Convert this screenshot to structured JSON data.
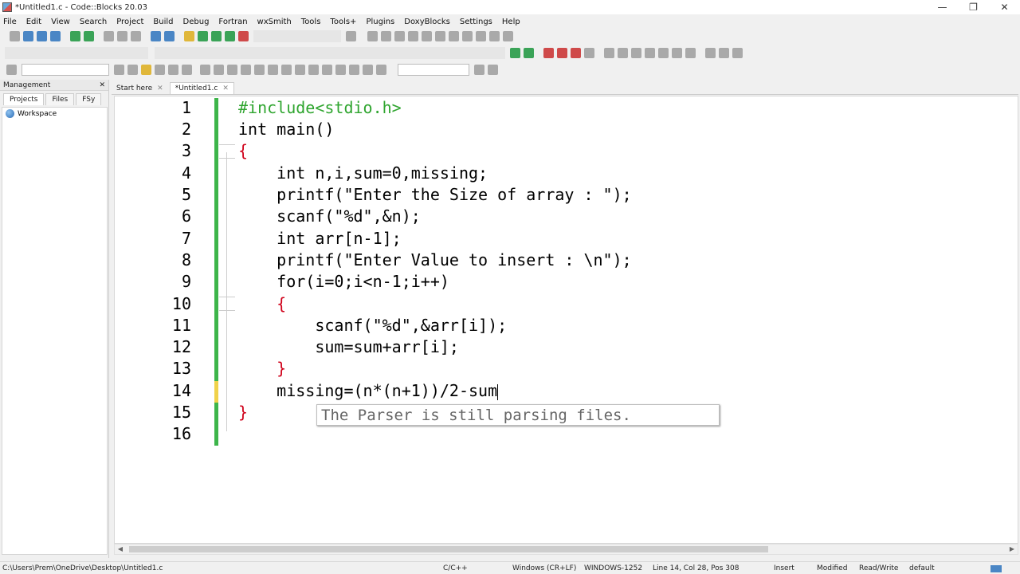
{
  "window": {
    "title": "*Untitled1.c - Code::Blocks 20.03",
    "minimize": "—",
    "maximize": "❐",
    "close": "✕"
  },
  "menu": [
    "File",
    "Edit",
    "View",
    "Search",
    "Project",
    "Build",
    "Debug",
    "Fortran",
    "wxSmith",
    "Tools",
    "Tools+",
    "Plugins",
    "DoxyBlocks",
    "Settings",
    "Help"
  ],
  "management": {
    "title": "Management",
    "close": "✕",
    "tabs": [
      "Projects",
      "Files",
      "FSy"
    ],
    "workspace": "Workspace"
  },
  "editor_tabs": [
    {
      "label": "Start here"
    },
    {
      "label": "*Untitled1.c"
    }
  ],
  "code": {
    "lines": [
      "#include<stdio.h>",
      "int main()",
      "{",
      "    int n,i,sum=0,missing;",
      "    printf(\"Enter the Size of array : \");",
      "    scanf(\"%d\",&n);",
      "    int arr[n-1];",
      "    printf(\"Enter Value to insert : \\n\");",
      "    for(i=0;i<n-1;i++)",
      "    {",
      "        scanf(\"%d\",&arr[i]);",
      "        sum=sum+arr[i];",
      "    }",
      "    missing=(n*(n+1))/2-sum",
      "}",
      ""
    ],
    "line_numbers": [
      "1",
      "2",
      "3",
      "4",
      "5",
      "6",
      "7",
      "8",
      "9",
      "10",
      "11",
      "12",
      "13",
      "14",
      "15",
      "16"
    ]
  },
  "tooltip": "The Parser is still parsing files.",
  "statusbar": {
    "path": "C:\\Users\\Prem\\OneDrive\\Desktop\\Untitled1.c",
    "language": "C/C++",
    "line_endings": "Windows (CR+LF)",
    "encoding": "WINDOWS-1252",
    "position": "Line 14, Col 28, Pos 308",
    "mode": "Insert",
    "modified": "Modified",
    "access": "Read/Write",
    "profile": "default"
  }
}
